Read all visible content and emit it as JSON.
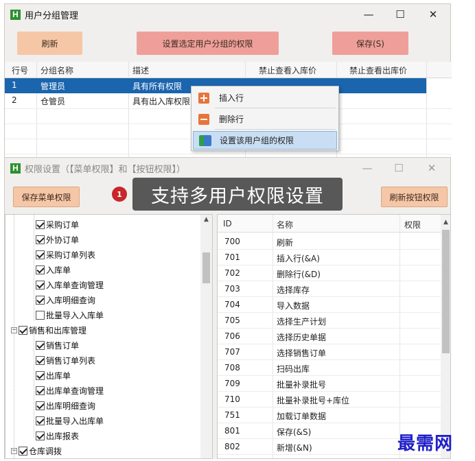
{
  "window1": {
    "title": "用户分组管理",
    "icon_letter": "H",
    "controls": {
      "minimize": "—",
      "maximize": "☐",
      "close": "✕"
    },
    "buttons": {
      "refresh": "刷新",
      "set_perm": "设置选定用户分组的权限",
      "save": "保存(S)"
    },
    "grid": {
      "columns": [
        "行号",
        "分组名称",
        "描述",
        "禁止查看入库价",
        "禁止查看出库价"
      ],
      "rows": [
        {
          "num": "1",
          "name": "管理员",
          "desc": "具有所有权限"
        },
        {
          "num": "2",
          "name": "仓管员",
          "desc": "具有出入库权限"
        }
      ]
    },
    "context_menu": {
      "insert_row": "插入行",
      "delete_row": "删除行",
      "set_group_perm": "设置该用户组的权限"
    }
  },
  "window2": {
    "title": "权限设置（【菜单权限】和【按钮权限】）",
    "icon_letter": "H",
    "controls": {
      "minimize": "—",
      "maximize": "☐",
      "close": "✕"
    },
    "buttons": {
      "save_menu": "保存菜单权限",
      "refresh_btn": "刷新按钮权限"
    },
    "tip": {
      "badge": "1",
      "text": "支持多用户权限设置"
    },
    "tree": {
      "items": [
        {
          "label": "采购订单",
          "checked": true,
          "level": 2
        },
        {
          "label": "外协订单",
          "checked": true,
          "level": 2
        },
        {
          "label": "采购订单列表",
          "checked": true,
          "level": 2
        },
        {
          "label": "入库单",
          "checked": true,
          "level": 2
        },
        {
          "label": "入库单查询管理",
          "checked": true,
          "level": 2
        },
        {
          "label": "入库明细查询",
          "checked": true,
          "level": 2
        },
        {
          "label": "批量导入入库单",
          "checked": false,
          "level": 2
        },
        {
          "label": "销售和出库管理",
          "checked": true,
          "level": 1
        },
        {
          "label": "销售订单",
          "checked": true,
          "level": 2
        },
        {
          "label": "销售订单列表",
          "checked": true,
          "level": 2
        },
        {
          "label": "出库单",
          "checked": true,
          "level": 2
        },
        {
          "label": "出库单查询管理",
          "checked": true,
          "level": 2
        },
        {
          "label": "出库明细查询",
          "checked": true,
          "level": 2
        },
        {
          "label": "批量导入出库单",
          "checked": true,
          "level": 2
        },
        {
          "label": "出库报表",
          "checked": true,
          "level": 2
        },
        {
          "label": "仓库调拨",
          "checked": true,
          "level": 1
        }
      ]
    },
    "list": {
      "columns": [
        "ID",
        "名称",
        "权限"
      ],
      "rows": [
        {
          "id": "700",
          "name": "刷新"
        },
        {
          "id": "701",
          "name": "插入行(&A)"
        },
        {
          "id": "702",
          "name": "删除行(&D)"
        },
        {
          "id": "703",
          "name": "选择库存"
        },
        {
          "id": "704",
          "name": "导入数据"
        },
        {
          "id": "705",
          "name": "选择生产计划"
        },
        {
          "id": "706",
          "name": "选择历史单据"
        },
        {
          "id": "707",
          "name": "选择销售订单"
        },
        {
          "id": "708",
          "name": "扫码出库"
        },
        {
          "id": "709",
          "name": "批量补录批号"
        },
        {
          "id": "710",
          "name": "批量补录批号+库位"
        },
        {
          "id": "751",
          "name": "加载订单数据"
        },
        {
          "id": "801",
          "name": "保存(&S)"
        },
        {
          "id": "802",
          "name": "新增(&N)"
        }
      ]
    }
  },
  "watermark": "最需网"
}
